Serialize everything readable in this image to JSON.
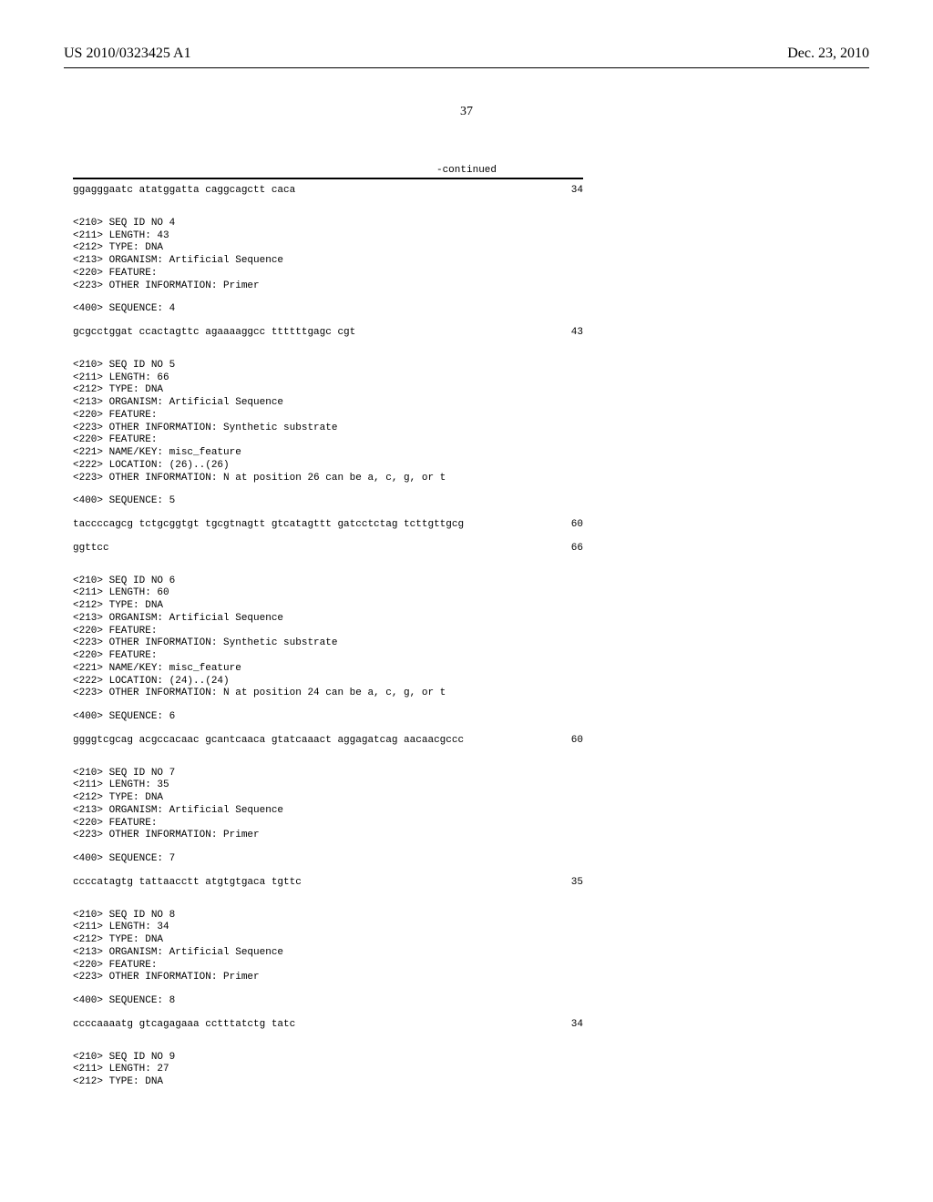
{
  "header": {
    "left": "US 2010/0323425 A1",
    "right": "Dec. 23, 2010"
  },
  "page_number": "37",
  "continued_label": "-continued",
  "entries": [
    {
      "type": "seq",
      "text": "ggagggaatc atatggatta caggcagctt caca",
      "num": "34"
    },
    {
      "type": "gap-lg"
    },
    {
      "type": "meta",
      "text": "<210> SEQ ID NO 4"
    },
    {
      "type": "meta",
      "text": "<211> LENGTH: 43"
    },
    {
      "type": "meta",
      "text": "<212> TYPE: DNA"
    },
    {
      "type": "meta",
      "text": "<213> ORGANISM: Artificial Sequence"
    },
    {
      "type": "meta",
      "text": "<220> FEATURE:"
    },
    {
      "type": "meta",
      "text": "<223> OTHER INFORMATION: Primer"
    },
    {
      "type": "gap"
    },
    {
      "type": "meta",
      "text": "<400> SEQUENCE: 4"
    },
    {
      "type": "gap"
    },
    {
      "type": "seq",
      "text": "gcgcctggat ccactagttc agaaaaggcc ttttttgagc cgt",
      "num": "43"
    },
    {
      "type": "gap-lg"
    },
    {
      "type": "meta",
      "text": "<210> SEQ ID NO 5"
    },
    {
      "type": "meta",
      "text": "<211> LENGTH: 66"
    },
    {
      "type": "meta",
      "text": "<212> TYPE: DNA"
    },
    {
      "type": "meta",
      "text": "<213> ORGANISM: Artificial Sequence"
    },
    {
      "type": "meta",
      "text": "<220> FEATURE:"
    },
    {
      "type": "meta",
      "text": "<223> OTHER INFORMATION: Synthetic substrate"
    },
    {
      "type": "meta",
      "text": "<220> FEATURE:"
    },
    {
      "type": "meta",
      "text": "<221> NAME/KEY: misc_feature"
    },
    {
      "type": "meta",
      "text": "<222> LOCATION: (26)..(26)"
    },
    {
      "type": "meta",
      "text": "<223> OTHER INFORMATION: N at position 26 can be a, c, g, or t"
    },
    {
      "type": "gap"
    },
    {
      "type": "meta",
      "text": "<400> SEQUENCE: 5"
    },
    {
      "type": "gap"
    },
    {
      "type": "seq",
      "text": "taccccagcg tctgcggtgt tgcgtnagtt gtcatagttt gatcctctag tcttgttgcg",
      "num": "60"
    },
    {
      "type": "gap"
    },
    {
      "type": "seq",
      "text": "ggttcc",
      "num": "66"
    },
    {
      "type": "gap-lg"
    },
    {
      "type": "meta",
      "text": "<210> SEQ ID NO 6"
    },
    {
      "type": "meta",
      "text": "<211> LENGTH: 60"
    },
    {
      "type": "meta",
      "text": "<212> TYPE: DNA"
    },
    {
      "type": "meta",
      "text": "<213> ORGANISM: Artificial Sequence"
    },
    {
      "type": "meta",
      "text": "<220> FEATURE:"
    },
    {
      "type": "meta",
      "text": "<223> OTHER INFORMATION: Synthetic substrate"
    },
    {
      "type": "meta",
      "text": "<220> FEATURE:"
    },
    {
      "type": "meta",
      "text": "<221> NAME/KEY: misc_feature"
    },
    {
      "type": "meta",
      "text": "<222> LOCATION: (24)..(24)"
    },
    {
      "type": "meta",
      "text": "<223> OTHER INFORMATION: N at position 24 can be a, c, g, or t"
    },
    {
      "type": "gap"
    },
    {
      "type": "meta",
      "text": "<400> SEQUENCE: 6"
    },
    {
      "type": "gap"
    },
    {
      "type": "seq",
      "text": "ggggtcgcag acgccacaac gcantcaaca gtatcaaact aggagatcag aacaacgccc",
      "num": "60"
    },
    {
      "type": "gap-lg"
    },
    {
      "type": "meta",
      "text": "<210> SEQ ID NO 7"
    },
    {
      "type": "meta",
      "text": "<211> LENGTH: 35"
    },
    {
      "type": "meta",
      "text": "<212> TYPE: DNA"
    },
    {
      "type": "meta",
      "text": "<213> ORGANISM: Artificial Sequence"
    },
    {
      "type": "meta",
      "text": "<220> FEATURE:"
    },
    {
      "type": "meta",
      "text": "<223> OTHER INFORMATION: Primer"
    },
    {
      "type": "gap"
    },
    {
      "type": "meta",
      "text": "<400> SEQUENCE: 7"
    },
    {
      "type": "gap"
    },
    {
      "type": "seq",
      "text": "ccccatagtg tattaacctt atgtgtgaca tgttc",
      "num": "35"
    },
    {
      "type": "gap-lg"
    },
    {
      "type": "meta",
      "text": "<210> SEQ ID NO 8"
    },
    {
      "type": "meta",
      "text": "<211> LENGTH: 34"
    },
    {
      "type": "meta",
      "text": "<212> TYPE: DNA"
    },
    {
      "type": "meta",
      "text": "<213> ORGANISM: Artificial Sequence"
    },
    {
      "type": "meta",
      "text": "<220> FEATURE:"
    },
    {
      "type": "meta",
      "text": "<223> OTHER INFORMATION: Primer"
    },
    {
      "type": "gap"
    },
    {
      "type": "meta",
      "text": "<400> SEQUENCE: 8"
    },
    {
      "type": "gap"
    },
    {
      "type": "seq",
      "text": "ccccaaaatg gtcagagaaa cctttatctg tatc",
      "num": "34"
    },
    {
      "type": "gap-lg"
    },
    {
      "type": "meta",
      "text": "<210> SEQ ID NO 9"
    },
    {
      "type": "meta",
      "text": "<211> LENGTH: 27"
    },
    {
      "type": "meta",
      "text": "<212> TYPE: DNA"
    }
  ]
}
